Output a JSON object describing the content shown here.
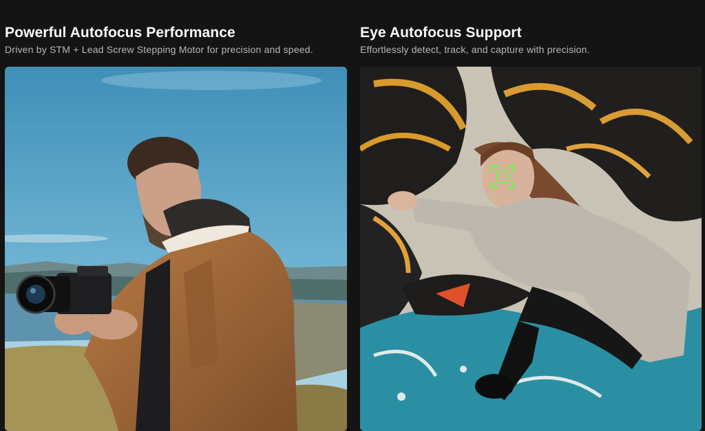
{
  "features": [
    {
      "title": "Powerful Autofocus Performance",
      "subtitle": "Driven by STM + Lead Screw Stepping Motor for precision and speed.",
      "image": "man-with-camera-photo"
    },
    {
      "title": "Eye Autofocus Support",
      "subtitle": "Effortlessly detect, track, and capture with precision.",
      "image": "woman-graffiti-eye-af-photo"
    }
  ],
  "colors": {
    "background": "#141414",
    "eye_af_box": "#5cff3a"
  }
}
